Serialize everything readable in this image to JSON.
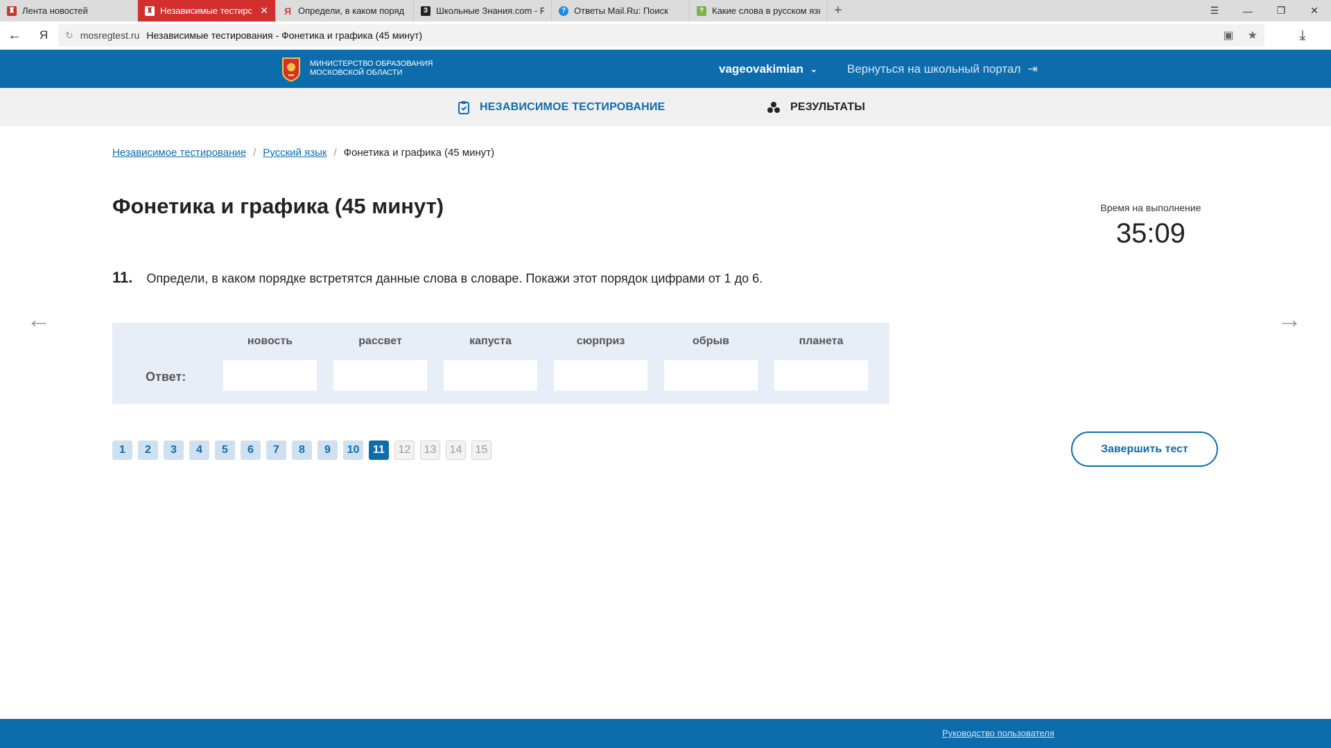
{
  "browser": {
    "tabs": [
      {
        "label": "Лента новостей",
        "icon": "msk-emblem-icon",
        "active": false
      },
      {
        "label": "Независимые тестирова",
        "icon": "msk-emblem-icon",
        "active": true
      },
      {
        "label": "Определи, в каком поряд",
        "icon": "yandex-icon",
        "active": false
      },
      {
        "label": "Школьные Знания.com - Ре",
        "icon": "znania-icon",
        "active": false
      },
      {
        "label": "Ответы Mail.Ru: Поиск",
        "icon": "mailru-answers-icon",
        "active": false
      },
      {
        "label": "Какие слова в русском язы",
        "icon": "doc-icon",
        "active": false
      }
    ],
    "new_tab": "+",
    "address": {
      "domain": "mosregtest.ru",
      "page_title": "Независимые тестирования - Фонетика и графика (45 минут)"
    }
  },
  "header": {
    "ministry_line1": "Министерство образования",
    "ministry_line2": "Московской области",
    "username": "vageovakimian",
    "back_link": "Вернуться на школьный портал"
  },
  "subnav": {
    "tests": "НЕЗАВИСИМОЕ ТЕСТИРОВАНИЕ",
    "results": "РЕЗУЛЬТАТЫ"
  },
  "breadcrumb": {
    "item1": "Независимое тестирование",
    "item2": "Русский язык",
    "current": "Фонетика и графика (45 минут)"
  },
  "page": {
    "title": "Фонетика и графика (45 минут)",
    "timer_label": "Время на выполнение",
    "timer_value": "35:09"
  },
  "question": {
    "number": "11.",
    "text": "Определи, в каком порядке встретятся данные слова в словаре. Покажи этот порядок цифрами от 1 до 6.",
    "answer_label": "Ответ:",
    "words": [
      "новость",
      "рассвет",
      "капуста",
      "сюрприз",
      "обрыв",
      "планета"
    ],
    "answers": [
      "",
      "",
      "",
      "",
      "",
      ""
    ]
  },
  "pager": {
    "pages": [
      "1",
      "2",
      "3",
      "4",
      "5",
      "6",
      "7",
      "8",
      "9",
      "10",
      "11",
      "12",
      "13",
      "14",
      "15"
    ],
    "current": "11",
    "answered_up_to": 10
  },
  "finish_button": "Завершить тест",
  "footer": {
    "guide_link": "Руководство пользователя"
  },
  "colors": {
    "brand_blue": "#0d6cac",
    "active_tab": "#d32f2f",
    "answer_bg": "#e8eef7"
  }
}
